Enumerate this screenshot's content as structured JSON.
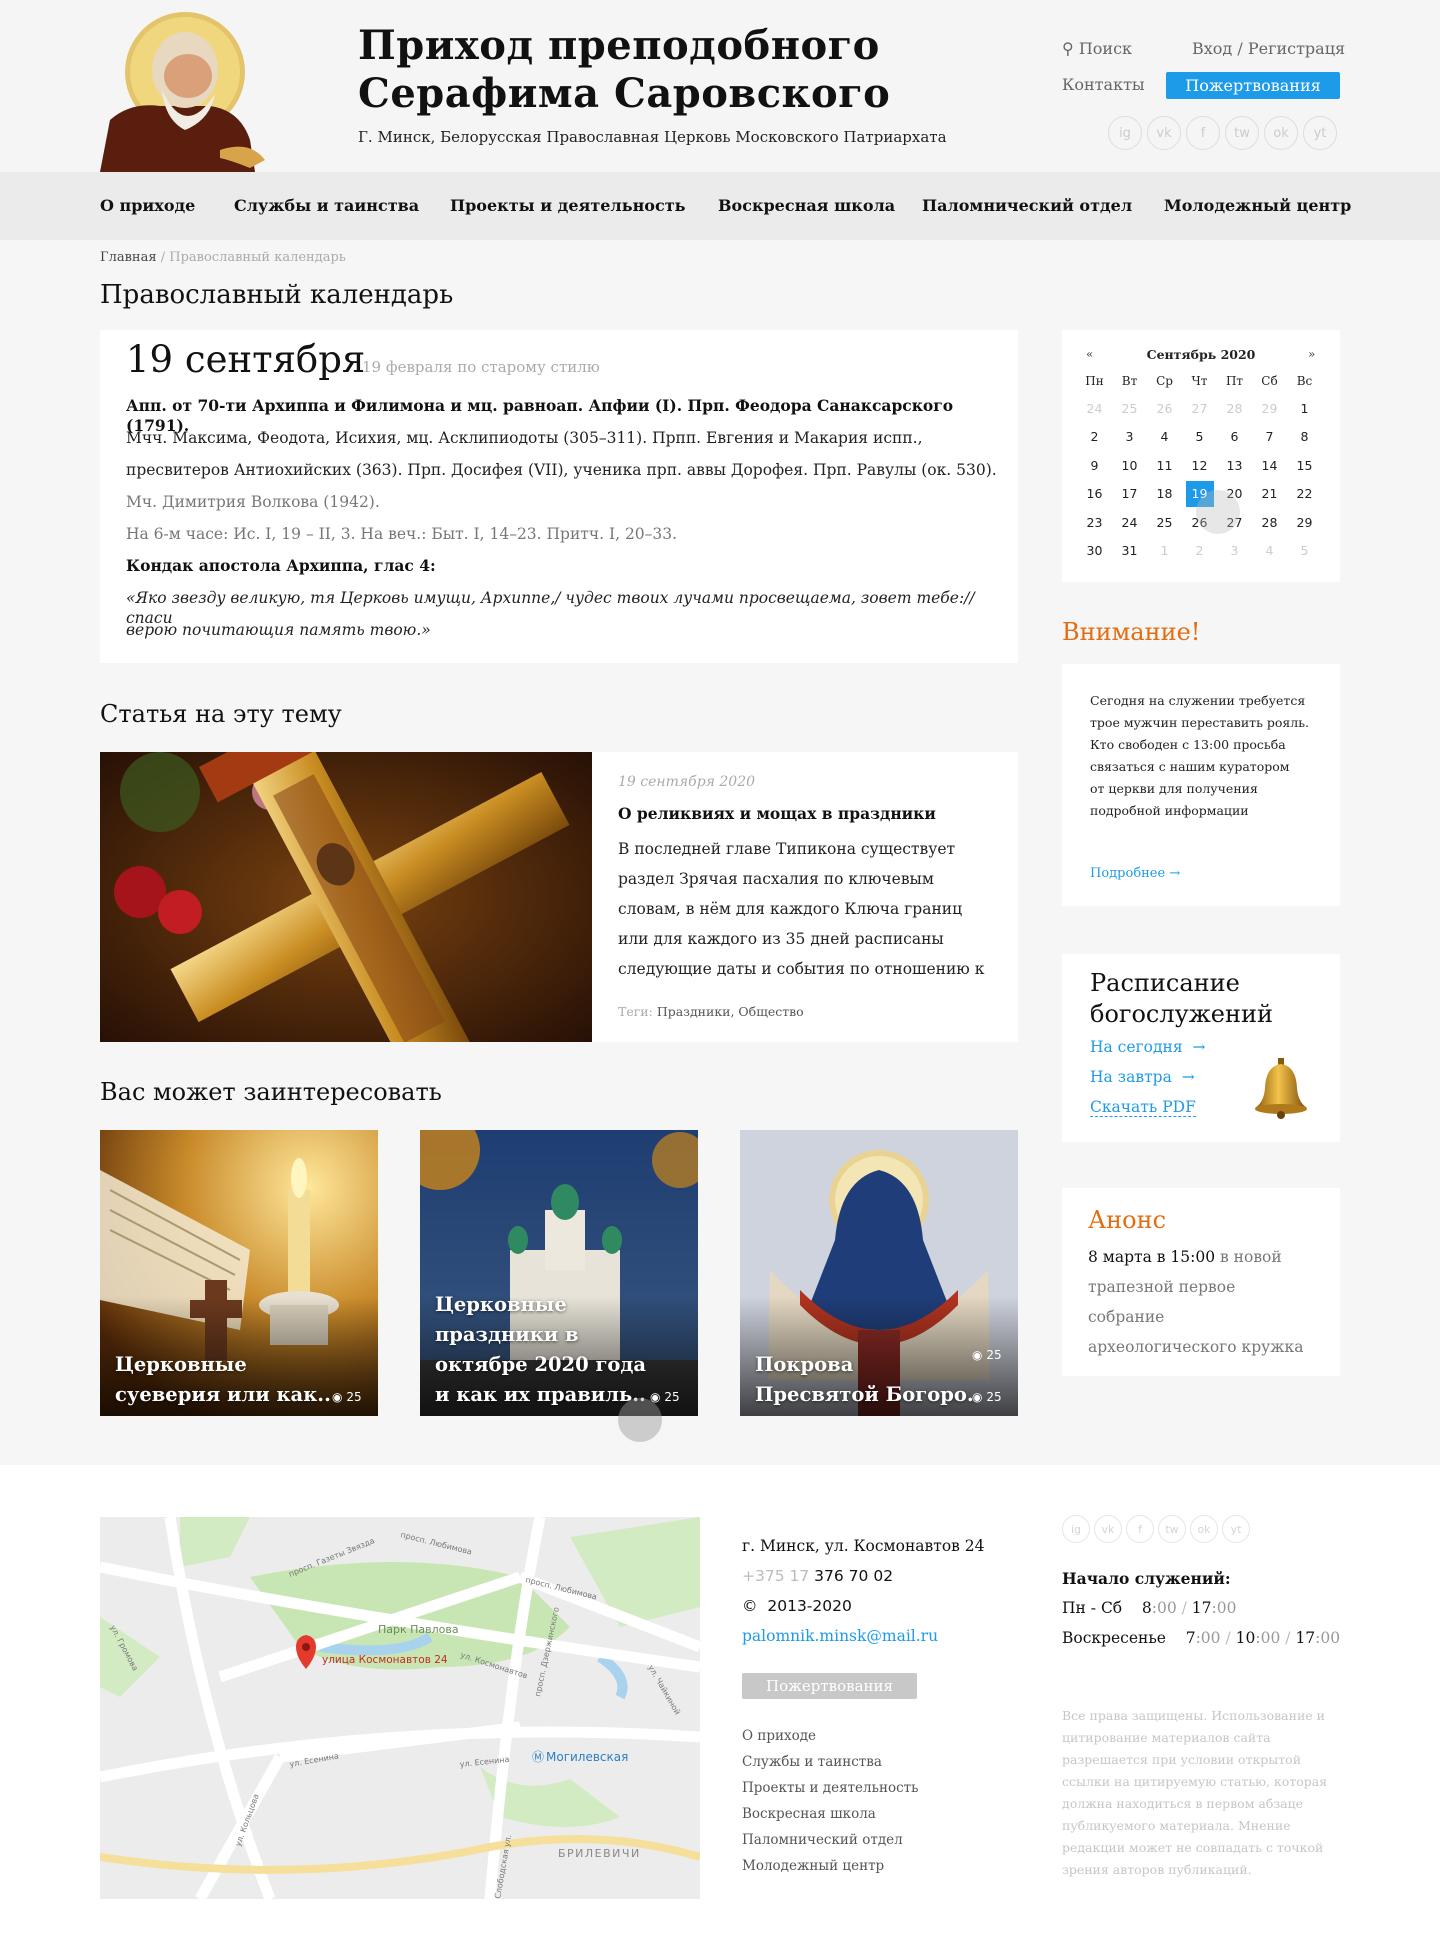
{
  "header": {
    "title_line1": "Приход преподобного",
    "title_line2": "Серафима Саровского",
    "subtitle": "Г. Минск, Белорусская Православная Церковь Московского Патриархата",
    "search": "Поиск",
    "login": "Вход / Регистраця",
    "contacts": "Контакты",
    "donate": "Пожертвования",
    "social": [
      "ig",
      "vk",
      "f",
      "tw",
      "ok",
      "yt"
    ]
  },
  "nav": [
    "О приходе",
    "Службы и таинства",
    "Проекты и деятельность",
    "Воскресная школа",
    "Паломнический отдел",
    "Молодежный центр"
  ],
  "breadcrumbs": {
    "home": "Главная",
    "sep": "/",
    "current": "Православный календарь"
  },
  "page_title": "Православный календарь",
  "day": {
    "date": "19 сентября",
    "old_style": "19 февраля по старому стилю",
    "lines": [
      "Апп. от 70-ти Архиппа и Филимона и мц. равноап. Апфии (I). Прп. Феодора Санаксарского (1791).",
      "Мчч. Максима, Феодота, Исихия, мц. Асклипиодоты (305–311). Прпп. Евгения и Макария испп.,",
      "пресвитеров Антиохийских (363). Прп. Досифея (VII), ученика прп. аввы Дорофея. Прп. Равулы (ок. 530).",
      "Мч. Димитрия Волкова (1942).",
      "На 6-м часе: Ис. I, 19 – II, 3. На веч.: Быт. I, 14–23. Притч. I, 20–33.",
      "Кондак апостола Архиппа, глас 4:",
      "«Яко звезду великую, тя Церковь имущи, Архиппе,/ чудес твоих лучами просвещаема, зовет тебе:// спаси",
      "верою почитающия память твою.»"
    ]
  },
  "article_section": {
    "heading": "Статья на эту тему",
    "date": "19 сентября 2020",
    "title": "О реликвиях и мощах в праздники",
    "text": [
      "В последней главе Типикона существует",
      "раздел Зрячая пасхалия по ключевым",
      "словам, в нём для каждого Ключа границ",
      "или для каждого из 35 дней расписаны",
      "следующие даты и события по отношению к"
    ],
    "tags_label": "Теги:",
    "tags": "Праздники, Общество"
  },
  "interest": {
    "heading": "Вас может заинтересовать",
    "items": [
      {
        "title1": "Церковные",
        "title2": "суеверия или как..",
        "views": "25"
      },
      {
        "title1": "Церковные",
        "title2": "праздники в",
        "title3": "октябре 2020 года",
        "title4": "и как их правиль..",
        "views": "25"
      },
      {
        "title1": "Покрова",
        "title2": "Пресвятой Богоро..",
        "views": "25",
        "views_top": "25"
      }
    ]
  },
  "calendar": {
    "prev": "«",
    "next": "»",
    "month": "Сентябрь 2020",
    "weekdays": [
      "Пн",
      "Вт",
      "Ср",
      "Чт",
      "Пт",
      "Сб",
      "Вс"
    ],
    "weeks": [
      [
        "24",
        "25",
        "26",
        "27",
        "28",
        "29",
        "1"
      ],
      [
        "2",
        "3",
        "4",
        "5",
        "6",
        "7",
        "8"
      ],
      [
        "9",
        "10",
        "11",
        "12",
        "13",
        "14",
        "15"
      ],
      [
        "16",
        "17",
        "18",
        "19",
        "20",
        "21",
        "22"
      ],
      [
        "23",
        "24",
        "25",
        "26",
        "27",
        "28",
        "29"
      ],
      [
        "30",
        "31",
        "1",
        "2",
        "3",
        "4",
        "5"
      ]
    ],
    "today": "19"
  },
  "attention": {
    "heading": "Внимание!",
    "lines": [
      "Сегодня на служении требуется",
      "трое мужчин переставить рояль.",
      "Кто свободен с 13:00 просьба",
      "связаться с нашим куратором",
      "от церкви для получения",
      "подробной информации"
    ],
    "more": "Подробнее →"
  },
  "schedule": {
    "heading1": "Расписание",
    "heading2": "богослужений",
    "today": "На сегодня",
    "tomorrow": "На завтра",
    "pdf": "Скачать PDF",
    "arrow": "→"
  },
  "announce": {
    "heading": "Анонс",
    "date": "8 марта в 15:00",
    "lines": [
      "в новой",
      "трапезной первое",
      "собрание",
      "археологического кружка"
    ]
  },
  "map": {
    "street": "улица Космонавтов 24",
    "park": "Парк Павлова",
    "metro": "Могилевская",
    "district": "БРИЛЕВИЧИ",
    "roads": [
      "просп. Газеты Звязда",
      "просп. Любимова",
      "просп. Любимова",
      "ул. Космонавтов",
      "просп. Дзержинского",
      "ул. Чайкиной",
      "ул. Громова",
      "ул. Есенина",
      "ул. Кольцова",
      "ул. Есенина",
      "Слободская ул."
    ]
  },
  "footer": {
    "address": "г. Минск, ул. Космонавтов 24",
    "phone_code": "+375 17",
    "phone": "376 70 02",
    "copyright_sign": "©",
    "years": "2013-2020",
    "email": "palomnik.minsk@mail.ru",
    "donate": "Пожертвования",
    "menu": [
      "О приходе",
      "Службы и таинства",
      "Проекты и деятельность",
      "Воскресная школа",
      "Паломнический отдел",
      "Молодежный центр"
    ],
    "services_heading": "Начало служений:",
    "weekdays_label": "Пн - Сб",
    "weekdays_times": [
      {
        "h": "8",
        "m": ":00"
      },
      {
        "h": "17",
        "m": ":00"
      }
    ],
    "sunday_label": "Воскресенье",
    "sunday_times": [
      {
        "h": "7",
        "m": ":00"
      },
      {
        "h": "10",
        "m": ":00"
      },
      {
        "h": "17",
        "m": ":00"
      }
    ],
    "rights": [
      "Все права защищены. Использование и",
      "цитирование материалов сайта",
      "разрешается при условии открытой",
      "ссылки на цитируемую статью, которая",
      "должна находиться в первом абзаце",
      "публикуемого материала. Мнение",
      "редакции может не совпадать с точкой",
      "зрения авторов публикаций."
    ]
  },
  "colors": {
    "accent": "#1e9be8",
    "orange": "#e36d12"
  }
}
